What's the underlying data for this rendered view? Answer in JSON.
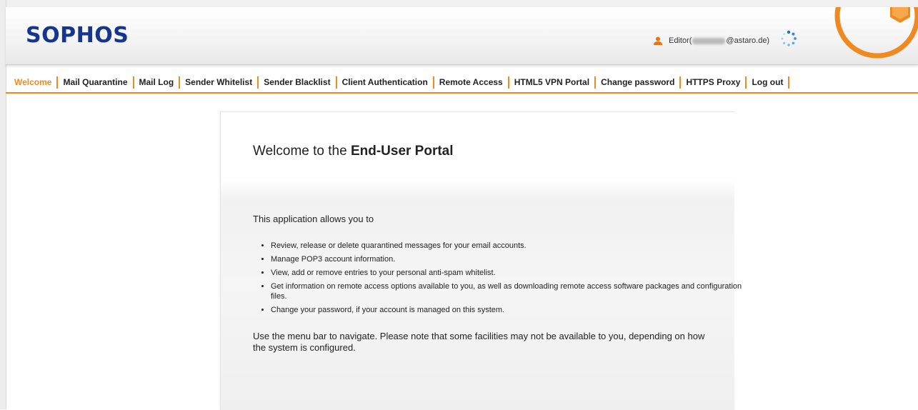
{
  "header": {
    "logo_text": "SOPHOS",
    "user_prefix": "Editor(",
    "user_suffix": "@astaro.de)",
    "accent_color": "#ee8a1f",
    "brand_color": "#15358f",
    "icons": [
      "user-icon",
      "loading-spinner-icon",
      "sophos-logo-mark"
    ]
  },
  "nav": {
    "items": [
      {
        "label": "Welcome",
        "active": true
      },
      {
        "label": "Mail Quarantine"
      },
      {
        "label": "Mail Log"
      },
      {
        "label": "Sender Whitelist"
      },
      {
        "label": "Sender Blacklist"
      },
      {
        "label": "Client Authentication"
      },
      {
        "label": "Remote Access"
      },
      {
        "label": "HTML5 VPN Portal"
      },
      {
        "label": "Change password"
      },
      {
        "label": "HTTPS Proxy"
      },
      {
        "label": "Log out"
      }
    ]
  },
  "main": {
    "title_prefix": "Welcome to the ",
    "title_bold": "End-User Portal",
    "intro": "This application allows you to",
    "bullets": [
      "Review, release or delete quarantined messages for your email accounts.",
      "Manage POP3 account information.",
      "View, add or remove entries to your personal anti-spam whitelist.",
      "Get information on remote access options available to you, as well as downloading remote access software packages and configuration files.",
      "Change your password, if your account is managed on this system."
    ],
    "outro": "Use the menu bar to navigate. Please note that some facilities may not be available to you, depending on how the system is configured."
  }
}
